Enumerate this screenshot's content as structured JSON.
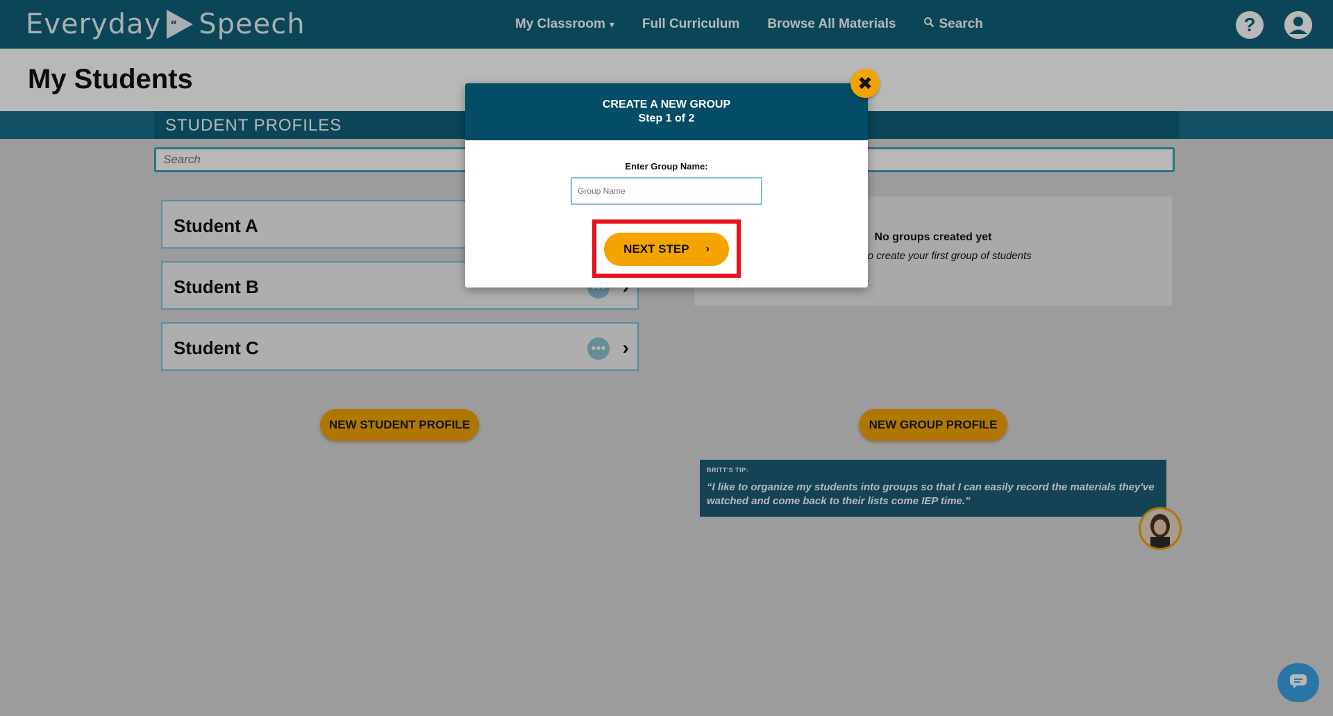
{
  "nav": {
    "logo_left": "Everyday",
    "logo_right": "Speech",
    "links": [
      {
        "label": "My Classroom",
        "dropdown": true
      },
      {
        "label": "Full Curriculum"
      },
      {
        "label": "Browse All Materials"
      },
      {
        "label": "Search",
        "icon": "search-icon"
      }
    ],
    "help_icon": "?",
    "account_icon": "user-icon"
  },
  "page": {
    "title": "My Students",
    "section_title": "STUDENT PROFILES",
    "search_placeholder": "Search"
  },
  "students": [
    {
      "name": "Student A"
    },
    {
      "name": "Student B"
    },
    {
      "name": "Student C"
    }
  ],
  "buttons": {
    "new_student": "NEW STUDENT PROFILE",
    "new_group": "NEW GROUP PROFILE"
  },
  "groups": {
    "empty_title": "No groups created yet",
    "empty_sub": "below to create your first group of students"
  },
  "tip": {
    "label": "BRITT'S TIP:",
    "text": "“I like to organize my students into groups so that I can easily record the materials they've watched and come back to their lists come IEP time.”"
  },
  "modal": {
    "title": "CREATE A NEW GROUP",
    "step": "Step 1 of 2",
    "field_label": "Enter Group Name:",
    "field_placeholder": "Group Name",
    "next_label": "NEXT STEP",
    "close_glyph": "✖",
    "highlight_color": "#e8121e"
  },
  "colors": {
    "nav": "#0e607a",
    "accent": "#f3a400",
    "modal_header": "#034d67"
  }
}
